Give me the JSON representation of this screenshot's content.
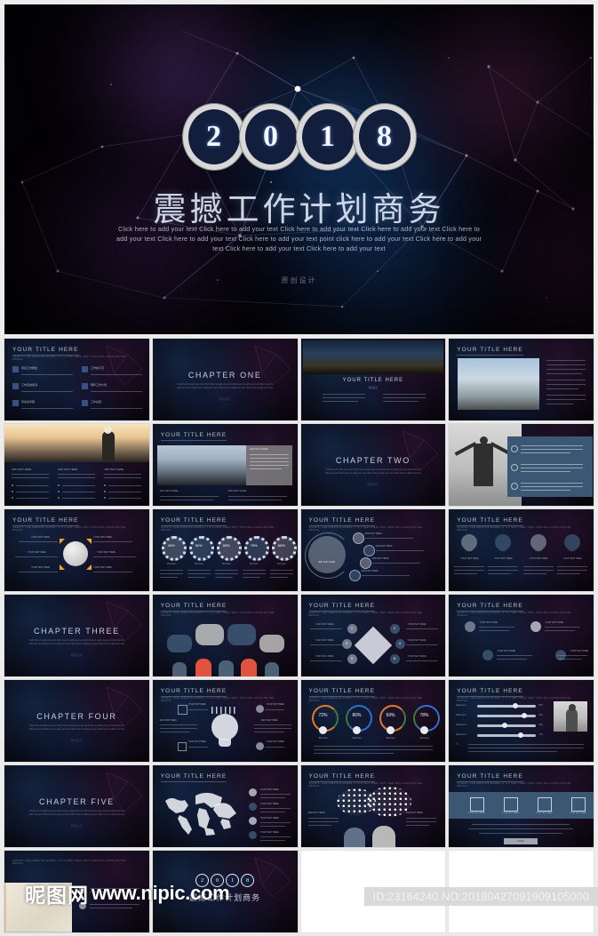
{
  "hero": {
    "year_digits": [
      "2",
      "0",
      "1",
      "8"
    ],
    "title": "震撼工作计划商务",
    "subtitle": "Click here to add your text Click here to add your text Click here to add your text Click here to add your text Click here to add your text Click here to add your text Click here to add your text point click here to add your text Click here to add your text Click here to add your text Click here to add your text",
    "credit": "原创设计"
  },
  "labels": {
    "your_title": "YOUR TITLE HERE",
    "your_title_sub": "CHARTS, LINE CREATIVE WORDS, IT IS A VERY IDEAL TEXT, THAT WILL CATCH ON THE DESIGN.",
    "add_text_here": "ADD TEXT HERE",
    "your_text_here": "YOUR TEXT HERE",
    "more": "MORE"
  },
  "chapters": {
    "one": "CHAPTER ONE",
    "two": "CHAPTER TWO",
    "three": "CHAPTER THREE",
    "four": "CHAPTER FOUR",
    "five": "CHAPTER FIVE",
    "body": "Click here to add your text Click here to add your text Click here to add your text Click here to add your text Click here to add your text Click here to add your text Click here to add your text",
    "credit": "原创设计"
  },
  "toc_items": [
    {
      "num": "1",
      "label": "项目工作概述"
    },
    {
      "num": "2",
      "label": "工作完成情况"
    },
    {
      "num": "3",
      "label": "存在的问题"
    },
    {
      "num": "4",
      "label": "工作的不足"
    },
    {
      "num": "5",
      "label": "明年工作计划"
    },
    {
      "num": "6",
      "label": "工作总结"
    }
  ],
  "percent_ring_slide": {
    "values": [
      "40%",
      "50%",
      "65%",
      "75%",
      "80%"
    ],
    "caption": "Text here"
  },
  "donut_slide": {
    "values": [
      "72%",
      "86%",
      "69%",
      "78%"
    ],
    "caption": "Text here",
    "colors": [
      "#e07a2a",
      "#2f6fd0",
      "#e07a2a",
      "#2f6fd0"
    ]
  },
  "diamond_slide": {
    "numbers": [
      "1",
      "2",
      "3",
      "4",
      "5",
      "6"
    ]
  },
  "slider_slide": {
    "rows": [
      "Data one in",
      "Data one in",
      "Data one in",
      "Data one in"
    ],
    "percents": [
      "65%",
      "78%",
      "48%",
      "72%"
    ]
  },
  "footer": {
    "watermark_cn": "昵图网",
    "watermark_url": "www.nipic.com",
    "id_text": "ID:23164240 NO:20180427091909105000"
  },
  "colors": {
    "page_bg": "#ececec",
    "slide_bg": "#06050a",
    "accent_blue": "#3c5773",
    "accent_orange": "#e07a2a",
    "year_circle": "#121e3c"
  }
}
